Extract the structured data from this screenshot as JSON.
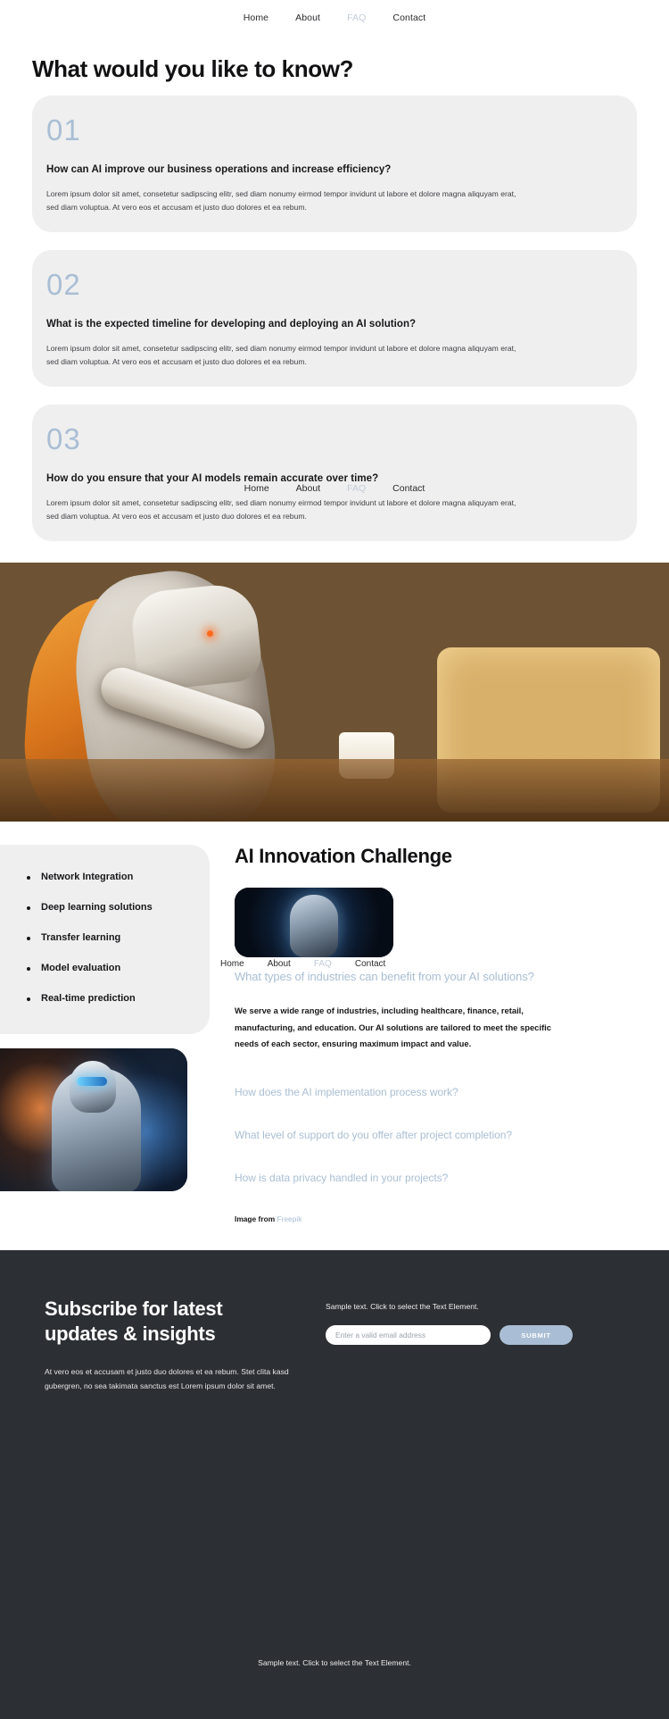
{
  "nav": {
    "items": [
      {
        "label": "Home",
        "muted": false
      },
      {
        "label": "About",
        "muted": false
      },
      {
        "label": "FAQ",
        "muted": true
      },
      {
        "label": "Contact",
        "muted": false
      }
    ]
  },
  "faq_section": {
    "title": "What would you like to know?",
    "body_text": "Lorem ipsum dolor sit amet, consetetur sadipscing elitr, sed diam nonumy eirmod tempor invidunt ut labore et dolore magna aliquyam erat, sed diam voluptua. At vero eos et accusam et justo duo dolores et ea rebum.",
    "items": [
      {
        "number": "01",
        "question": "How can AI improve our business operations and increase efficiency?",
        "answer": "Lorem ipsum dolor sit amet, consetetur sadipscing elitr, sed diam nonumy eirmod tempor invidunt ut labore et dolore magna aliquyam erat, sed diam voluptua. At vero eos et accusam et justo duo dolores et ea rebum."
      },
      {
        "number": "02",
        "question": "What is the expected timeline for developing and deploying an AI solution?",
        "answer": "Lorem ipsum dolor sit amet, consetetur sadipscing elitr, sed diam nonumy eirmod tempor invidunt ut labore et dolore magna aliquyam erat, sed diam voluptua. At vero eos et accusam et justo duo dolores et ea rebum."
      },
      {
        "number": "03",
        "question": "How do you ensure that your AI models remain accurate over time?",
        "answer": "Lorem ipsum dolor sit amet, consetetur sadipscing elitr, sed diam nonumy eirmod tempor invidunt ut labore et dolore magna aliquyam erat, sed diam voluptua. At vero eos et accusam et justo duo dolores et ea rebum."
      }
    ]
  },
  "hero_image": {
    "alt": "robot serving coffee at a counter"
  },
  "mid_section": {
    "title": "AI Innovation Challenge",
    "skills": [
      "Network Integration",
      "Deep learning solutions",
      "Transfer learning",
      "Model evaluation",
      "Real-time prediction"
    ],
    "thumb_alt": "robotic head close-up",
    "side_photo_alt": "humanoid robot in corridor",
    "open_question": "What types of industries can benefit from your AI solutions?",
    "open_answer": "We serve a wide range of industries, including healthcare, finance, retail, manufacturing, and education. Our AI solutions are tailored to meet the specific needs of each sector, ensuring maximum impact and value.",
    "collapsed_questions": [
      "How does the AI implementation process work?",
      "What level of support do you offer after project completion?",
      "How is data privacy handled in your projects?"
    ],
    "credit_label": "Image from",
    "credit_link": "Freepik"
  },
  "footer": {
    "heading": "Subscribe for latest updates & insights",
    "paragraph": "At vero eos et accusam et justo duo dolores et ea rebum. Stet clita kasd gubergren, no sea takimata sanctus est Lorem ipsum dolor sit amet.",
    "hint": "Sample text. Click to select the Text Element.",
    "email_placeholder": "Enter a valid email address",
    "email_value": "",
    "submit_label": "SUBMIT",
    "bottom_text": "Sample text. Click to select the Text Element.",
    "background": "#2c2f33",
    "accent": "#a9bed4"
  }
}
